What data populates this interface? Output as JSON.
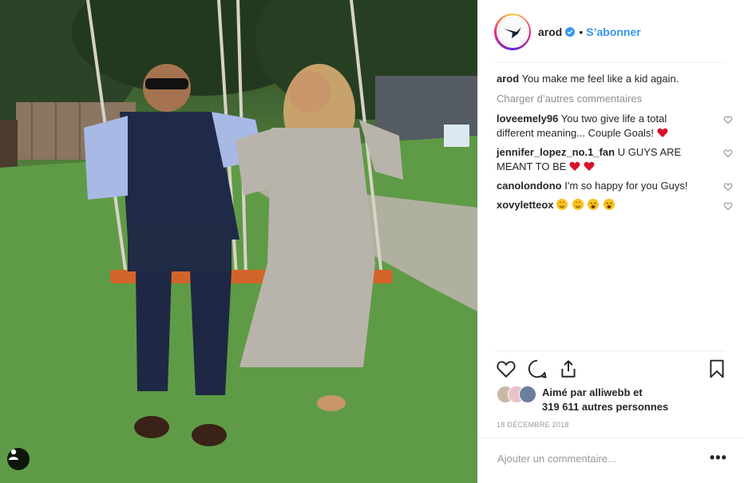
{
  "post": {
    "author": "arod",
    "follow_label": "S’abonner",
    "dot": "•",
    "caption": {
      "user": "arod",
      "text": "You make me feel like a kid again."
    },
    "load_more": "Charger d’autres commentaires",
    "comments": [
      {
        "user": "loveemely96",
        "text": "You two give life a total different meaning... Couple Goals!"
      },
      {
        "user": "jennifer_lopez_no.1_fan",
        "text": "U GUYS ARE MEANT TO BE"
      },
      {
        "user": "canolondono",
        "text": "I'm so happy for you Guys!"
      },
      {
        "user": "xovyletteox",
        "text": ""
      }
    ],
    "likes_line1": "Aimé par alliwebb et",
    "likes_line2": "319 611 autres personnes",
    "date": "18 DÉCEMBRE 2018",
    "comment_placeholder": "Ajouter un commentaire...",
    "more_label": "•••"
  },
  "icons": {
    "verified": "verified-badge-icon",
    "heart": "heart-icon",
    "comment": "comment-icon",
    "share": "share-icon",
    "save": "bookmark-icon",
    "user_tag": "user-tag-icon"
  },
  "colors": {
    "link_blue": "#3897f0",
    "muted": "#8e8e8e",
    "heart_red": "#ed4956"
  }
}
